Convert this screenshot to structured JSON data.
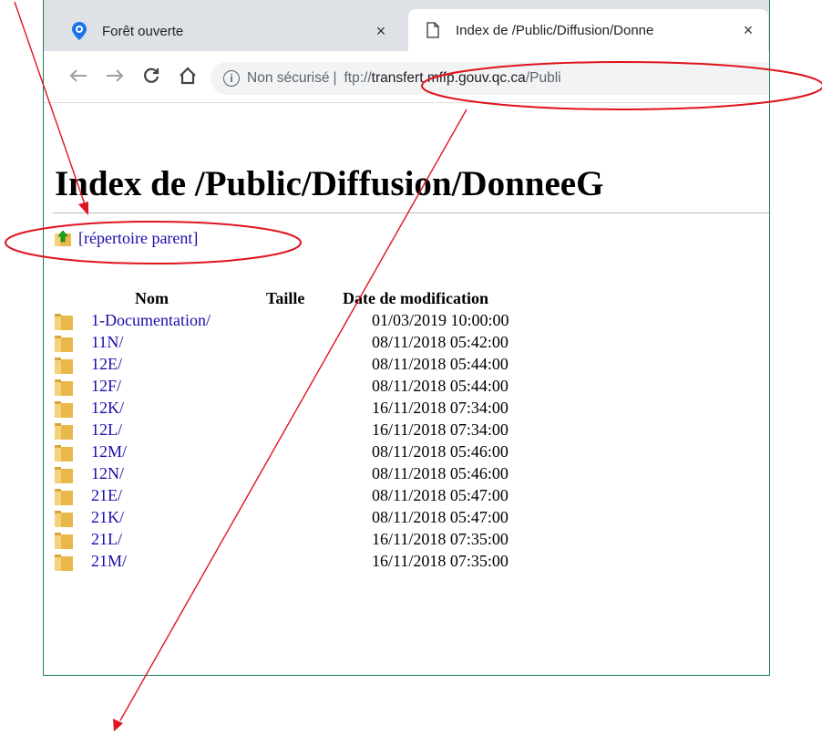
{
  "tabs": [
    {
      "label": "Forêt ouverte",
      "close": "×"
    },
    {
      "label": "Index de /Public/Diffusion/Donne",
      "close": "×"
    }
  ],
  "toolbar": {
    "security_label": "Non sécurisé",
    "separator": "|",
    "url_scheme": "ftp://",
    "url_host": "transfert.mffp.gouv.qc.ca",
    "url_path": "/Publi"
  },
  "page": {
    "title": "Index de /Public/Diffusion/DonneeG",
    "parent_link": "[répertoire parent]",
    "columns": {
      "name": "Nom",
      "size": "Taille",
      "date": "Date de modification"
    },
    "rows": [
      {
        "name": "1-Documentation/",
        "date": "01/03/2019 10:00:00"
      },
      {
        "name": "11N/",
        "date": "08/11/2018 05:42:00"
      },
      {
        "name": "12E/",
        "date": "08/11/2018 05:44:00"
      },
      {
        "name": "12F/",
        "date": "08/11/2018 05:44:00"
      },
      {
        "name": "12K/",
        "date": "16/11/2018 07:34:00"
      },
      {
        "name": "12L/",
        "date": "16/11/2018 07:34:00"
      },
      {
        "name": "12M/",
        "date": "08/11/2018 05:46:00"
      },
      {
        "name": "12N/",
        "date": "08/11/2018 05:46:00"
      },
      {
        "name": "21E/",
        "date": "08/11/2018 05:47:00"
      },
      {
        "name": "21K/",
        "date": "08/11/2018 05:47:00"
      },
      {
        "name": "21L/",
        "date": "16/11/2018 07:35:00"
      },
      {
        "name": "21M/",
        "date": "16/11/2018 07:35:00"
      }
    ]
  },
  "colors": {
    "annotation": "#e0141e",
    "link": "#1a0dab",
    "window_border": "#1a7a5e",
    "folder": "#e8b84a"
  }
}
